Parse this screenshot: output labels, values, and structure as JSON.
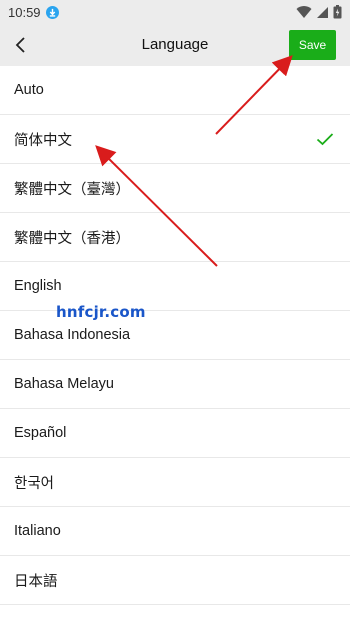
{
  "status_bar": {
    "time": "10:59",
    "icons": [
      "download-icon",
      "wifi-icon",
      "signal-icon",
      "battery-charging-icon"
    ]
  },
  "header": {
    "title": "Language",
    "back_icon": "back-chevron-icon",
    "save_label": "Save"
  },
  "languages": [
    {
      "label": "Auto",
      "selected": false
    },
    {
      "label": "简体中文",
      "selected": true
    },
    {
      "label": "繁體中文（臺灣）",
      "selected": false
    },
    {
      "label": "繁體中文（香港）",
      "selected": false
    },
    {
      "label": "English",
      "selected": false
    },
    {
      "label": "Bahasa Indonesia",
      "selected": false
    },
    {
      "label": "Bahasa Melayu",
      "selected": false
    },
    {
      "label": "Español",
      "selected": false
    },
    {
      "label": "한국어",
      "selected": false
    },
    {
      "label": "Italiano",
      "selected": false
    },
    {
      "label": "日本語",
      "selected": false
    }
  ],
  "watermark": "hnfcjr.com",
  "colors": {
    "accent": "#1aad19",
    "check": "#1aad19",
    "annotation_arrow": "#d91c1c",
    "watermark": "#1a56c9"
  }
}
